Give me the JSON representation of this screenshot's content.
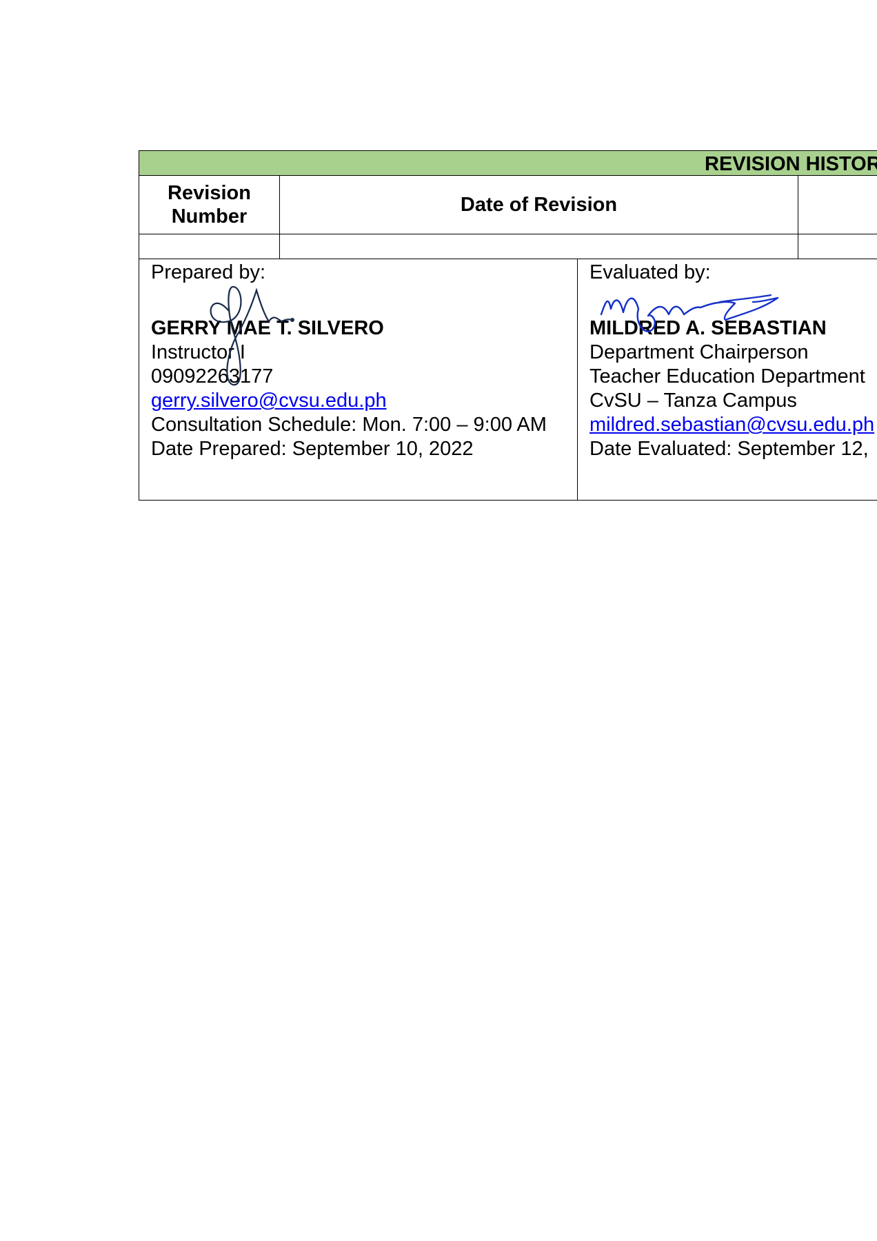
{
  "revision_history": {
    "title": "REVISION HISTOR",
    "columns": [
      "Revision Number",
      "Date of Revision"
    ],
    "rows": [
      {
        "revision_number": "",
        "date_of_revision": ""
      }
    ]
  },
  "prepared_by": {
    "label": "Prepared by:",
    "name": "GERRY MAE T. SILVERO",
    "position": "Instructor I",
    "phone": "09092263177",
    "email": "gerry.silvero@cvsu.edu.ph",
    "schedule": "Consultation Schedule: Mon. 7:00 – 9:00 AM",
    "date": "Date Prepared: September 10, 2022",
    "signature_color": "#1a2a4a"
  },
  "evaluated_by": {
    "label": "Evaluated by:",
    "name": "MILDRED A. SEBASTIAN",
    "position": "Department Chairperson",
    "department": "Teacher Education Department",
    "campus": "CvSU – Tanza Campus",
    "email": "mildred.sebastian@cvsu.edu.ph",
    "date": "Date Evaluated: September 12,",
    "signature_color": "#1530c8"
  },
  "colors": {
    "header_background": "#a9d18e",
    "link": "#0000ee"
  }
}
